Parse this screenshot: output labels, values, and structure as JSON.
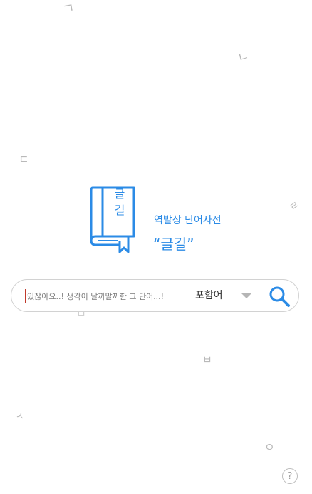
{
  "background_jamo": [
    "ㄱ",
    "ㄴ",
    "ㄷ",
    "ㄹ",
    "ㅁ",
    "ㅂ",
    "ㅅ",
    "ㅇ"
  ],
  "logo": {
    "book_text_line1": "글",
    "book_text_line2": "길",
    "tagline": "역발상 단어사전",
    "brand": "“글길”"
  },
  "search": {
    "placeholder": "있잖아요..! 생각이 날까말까한 그 단어...!",
    "mode_label": "포함어"
  },
  "help_label": "?",
  "colors": {
    "accent": "#2b8be6",
    "caret": "#c0392b"
  }
}
